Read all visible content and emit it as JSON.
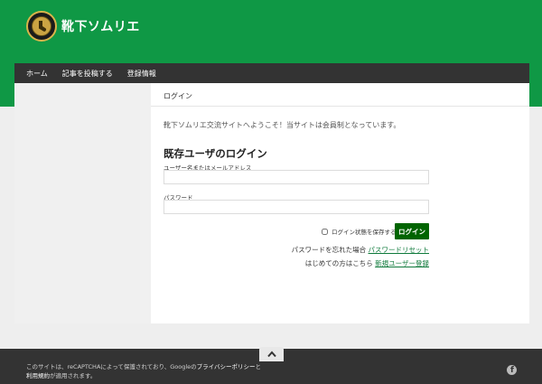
{
  "site": {
    "title": "靴下ソムリエ"
  },
  "nav": {
    "items": [
      "ホーム",
      "記事を投稿する",
      "登録情報"
    ]
  },
  "breadcrumb": "ログイン",
  "welcome": "靴下ソムリエ交流サイトへようこそ！当サイトは会員制となっています。",
  "login": {
    "heading": "既存ユーザのログイン",
    "username_label": "ユーザー名またはメールアドレス",
    "username_value": "",
    "password_label": "パスワード",
    "password_value": "",
    "remember_label": "ログイン状態を保存する",
    "button_label": "ログイン"
  },
  "links": {
    "forgot_prefix": "パスワードを忘れた場合",
    "forgot_link": "パスワードリセット",
    "register_prefix": "はじめての方はこちら",
    "register_link": "新規ユーザー登録"
  },
  "footer": {
    "text_part1": "このサイトは、reCAPTCHAによって保護されており、Googleの",
    "privacy_link": "プライバシーポリシー",
    "text_part2": "と",
    "terms_link": "利用規約",
    "text_part3": "が適用されます。"
  },
  "icons": {
    "logo": "sock-sommelier-logo",
    "scroll_top": "chevron-up-icon",
    "facebook": "facebook-icon"
  },
  "colors": {
    "brand_green": "#0f9845",
    "nav_dark": "#333333",
    "button_green": "#006400",
    "link_green": "#0f7a3b"
  }
}
